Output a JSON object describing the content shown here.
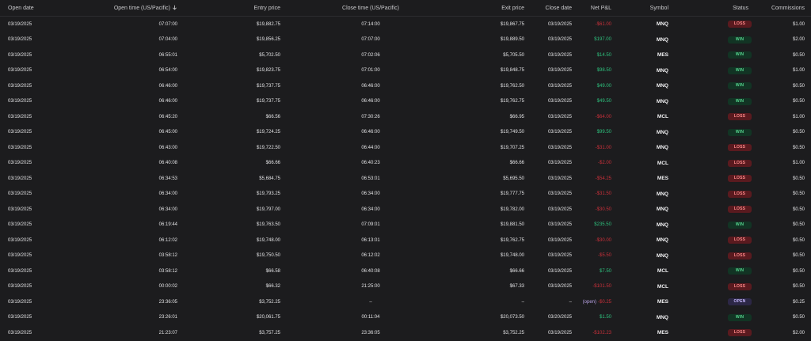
{
  "header": {
    "open_date": "Open date",
    "open_time": "Open time (US/Pacific)",
    "entry_price": "Entry price",
    "close_time": "Close time (US/Pacific)",
    "exit_price": "Exit price",
    "close_date": "Close date",
    "net_pnl": "Net P&L",
    "symbol": "Symbol",
    "status": "Status",
    "commissions": "Commissions"
  },
  "colors": {
    "win": "#2ec27e",
    "loss": "#c9303a",
    "open": "#b9a3e6",
    "background": "#1c1c1e"
  },
  "rows": [
    {
      "open_date": "03/19/2025",
      "open_time": "07:07:00",
      "entry": "$19,882.75",
      "close_time": "07:14:00",
      "exit": "$19,867.75",
      "close_date": "03/19/2025",
      "pnl": "-$61.00",
      "pnl_sign": "neg",
      "pnl_tag": "",
      "symbol": "MNQ",
      "status": "LOSS",
      "commission": "$1.00"
    },
    {
      "open_date": "03/19/2025",
      "open_time": "07:04:00",
      "entry": "$19,856.25",
      "close_time": "07:07:00",
      "exit": "$19,889.50",
      "close_date": "03/19/2025",
      "pnl": "$197.00",
      "pnl_sign": "pos",
      "pnl_tag": "",
      "symbol": "MNQ",
      "status": "WIN",
      "commission": "$2.00"
    },
    {
      "open_date": "03/19/2025",
      "open_time": "06:55:01",
      "entry": "$5,702.50",
      "close_time": "07:02:06",
      "exit": "$5,705.50",
      "close_date": "03/19/2025",
      "pnl": "$14.50",
      "pnl_sign": "pos",
      "pnl_tag": "",
      "symbol": "MES",
      "status": "WIN",
      "commission": "$0.50"
    },
    {
      "open_date": "03/19/2025",
      "open_time": "06:54:00",
      "entry": "$19,823.75",
      "close_time": "07:01:00",
      "exit": "$19,848.75",
      "close_date": "03/19/2025",
      "pnl": "$98.50",
      "pnl_sign": "pos",
      "pnl_tag": "",
      "symbol": "MNQ",
      "status": "WIN",
      "commission": "$1.00"
    },
    {
      "open_date": "03/19/2025",
      "open_time": "06:46:00",
      "entry": "$19,737.75",
      "close_time": "06:46:00",
      "exit": "$19,762.50",
      "close_date": "03/19/2025",
      "pnl": "$49.00",
      "pnl_sign": "pos",
      "pnl_tag": "",
      "symbol": "MNQ",
      "status": "WIN",
      "commission": "$0.50"
    },
    {
      "open_date": "03/19/2025",
      "open_time": "06:46:00",
      "entry": "$19,737.75",
      "close_time": "06:46:00",
      "exit": "$19,762.75",
      "close_date": "03/19/2025",
      "pnl": "$49.50",
      "pnl_sign": "pos",
      "pnl_tag": "",
      "symbol": "MNQ",
      "status": "WIN",
      "commission": "$0.50"
    },
    {
      "open_date": "03/19/2025",
      "open_time": "06:45:20",
      "entry": "$66.56",
      "close_time": "07:30:26",
      "exit": "$66.95",
      "close_date": "03/19/2025",
      "pnl": "-$64.00",
      "pnl_sign": "neg",
      "pnl_tag": "",
      "symbol": "MCL",
      "status": "LOSS",
      "commission": "$1.00"
    },
    {
      "open_date": "03/19/2025",
      "open_time": "06:45:00",
      "entry": "$19,724.25",
      "close_time": "06:46:00",
      "exit": "$19,749.50",
      "close_date": "03/19/2025",
      "pnl": "$99.50",
      "pnl_sign": "pos",
      "pnl_tag": "",
      "symbol": "MNQ",
      "status": "WIN",
      "commission": "$0.50"
    },
    {
      "open_date": "03/19/2025",
      "open_time": "06:43:00",
      "entry": "$19,722.50",
      "close_time": "06:44:00",
      "exit": "$19,707.25",
      "close_date": "03/19/2025",
      "pnl": "-$31.00",
      "pnl_sign": "neg",
      "pnl_tag": "",
      "symbol": "MNQ",
      "status": "LOSS",
      "commission": "$0.50"
    },
    {
      "open_date": "03/19/2025",
      "open_time": "06:40:08",
      "entry": "$66.66",
      "close_time": "06:40:23",
      "exit": "$66.66",
      "close_date": "03/19/2025",
      "pnl": "-$2.00",
      "pnl_sign": "neg",
      "pnl_tag": "",
      "symbol": "MCL",
      "status": "LOSS",
      "commission": "$1.00"
    },
    {
      "open_date": "03/19/2025",
      "open_time": "06:34:53",
      "entry": "$5,684.75",
      "close_time": "06:53:01",
      "exit": "$5,695.50",
      "close_date": "03/19/2025",
      "pnl": "-$54.25",
      "pnl_sign": "neg",
      "pnl_tag": "",
      "symbol": "MES",
      "status": "LOSS",
      "commission": "$0.50"
    },
    {
      "open_date": "03/19/2025",
      "open_time": "06:34:00",
      "entry": "$19,793.25",
      "close_time": "06:34:00",
      "exit": "$19,777.75",
      "close_date": "03/19/2025",
      "pnl": "-$31.50",
      "pnl_sign": "neg",
      "pnl_tag": "",
      "symbol": "MNQ",
      "status": "LOSS",
      "commission": "$0.50"
    },
    {
      "open_date": "03/19/2025",
      "open_time": "06:34:00",
      "entry": "$19,797.00",
      "close_time": "06:34:00",
      "exit": "$19,782.00",
      "close_date": "03/19/2025",
      "pnl": "-$30.50",
      "pnl_sign": "neg",
      "pnl_tag": "",
      "symbol": "MNQ",
      "status": "LOSS",
      "commission": "$0.50"
    },
    {
      "open_date": "03/19/2025",
      "open_time": "06:19:44",
      "entry": "$19,763.50",
      "close_time": "07:09:01",
      "exit": "$19,881.50",
      "close_date": "03/19/2025",
      "pnl": "$235.50",
      "pnl_sign": "pos",
      "pnl_tag": "",
      "symbol": "MNQ",
      "status": "WIN",
      "commission": "$0.50"
    },
    {
      "open_date": "03/19/2025",
      "open_time": "06:12:02",
      "entry": "$19,748.00",
      "close_time": "06:13:01",
      "exit": "$19,762.75",
      "close_date": "03/19/2025",
      "pnl": "-$30.00",
      "pnl_sign": "neg",
      "pnl_tag": "",
      "symbol": "MNQ",
      "status": "LOSS",
      "commission": "$0.50"
    },
    {
      "open_date": "03/19/2025",
      "open_time": "03:58:12",
      "entry": "$19,750.50",
      "close_time": "06:12:02",
      "exit": "$19,748.00",
      "close_date": "03/19/2025",
      "pnl": "-$5.50",
      "pnl_sign": "neg",
      "pnl_tag": "",
      "symbol": "MNQ",
      "status": "LOSS",
      "commission": "$0.50"
    },
    {
      "open_date": "03/19/2025",
      "open_time": "03:58:12",
      "entry": "$66.58",
      "close_time": "06:40:08",
      "exit": "$66.66",
      "close_date": "03/19/2025",
      "pnl": "$7.50",
      "pnl_sign": "pos",
      "pnl_tag": "",
      "symbol": "MCL",
      "status": "WIN",
      "commission": "$0.50"
    },
    {
      "open_date": "03/19/2025",
      "open_time": "00:00:02",
      "entry": "$66.32",
      "close_time": "21:25:00",
      "exit": "$67.33",
      "close_date": "03/19/2025",
      "pnl": "-$101.50",
      "pnl_sign": "neg",
      "pnl_tag": "",
      "symbol": "MCL",
      "status": "LOSS",
      "commission": "$0.50"
    },
    {
      "open_date": "03/19/2025",
      "open_time": "23:36:05",
      "entry": "$3,752.25",
      "close_time": "–",
      "exit": "–",
      "close_date": "–",
      "pnl": "-$0.25",
      "pnl_sign": "neg",
      "pnl_tag": "(open)",
      "symbol": "MES",
      "status": "OPEN",
      "commission": "$0.25"
    },
    {
      "open_date": "03/19/2025",
      "open_time": "23:26:01",
      "entry": "$20,061.75",
      "close_time": "00:11:04",
      "exit": "$20,073.50",
      "close_date": "03/20/2025",
      "pnl": "$1.50",
      "pnl_sign": "pos",
      "pnl_tag": "",
      "symbol": "MNQ",
      "status": "WIN",
      "commission": "$0.50"
    },
    {
      "open_date": "03/19/2025",
      "open_time": "21:23:07",
      "entry": "$3,757.25",
      "close_time": "23:36:05",
      "exit": "$3,752.25",
      "close_date": "03/19/2025",
      "pnl": "-$102.23",
      "pnl_sign": "neg",
      "pnl_tag": "",
      "symbol": "MES",
      "status": "LOSS",
      "commission": "$2.00"
    }
  ]
}
